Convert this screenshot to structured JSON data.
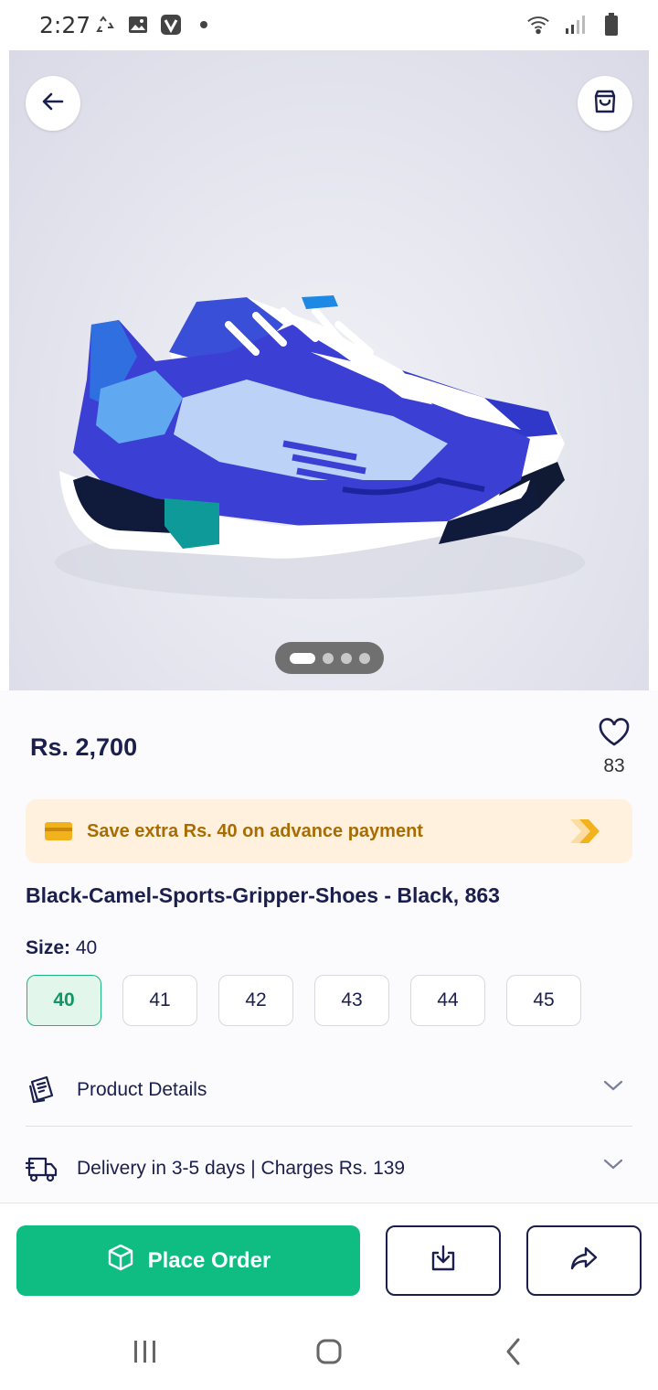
{
  "status_bar": {
    "time": "2:27",
    "left_icons": [
      "recycle-icon",
      "image-icon",
      "v-app-icon",
      "dot-icon"
    ],
    "right_icons": [
      "wifi-icon",
      "signal-icon",
      "battery-icon"
    ]
  },
  "hero": {
    "image": "blue-white-sports-shoe-photo",
    "pager": {
      "total": 4,
      "active_index": 0
    }
  },
  "product": {
    "price": "Rs. 2,700",
    "wishlist_count": "83",
    "promo_text": "Save extra Rs. 40 on advance payment",
    "title": "Black-Camel-Sports-Gripper-Shoes - Black, 863",
    "size_label": "Size:",
    "size_value": "40",
    "sizes": [
      "40",
      "41",
      "42",
      "43",
      "44",
      "45"
    ],
    "selected_size": "40"
  },
  "rows": {
    "details_label": "Product Details",
    "delivery_label": "Delivery in 3-5 days | Charges Rs. 139"
  },
  "actions": {
    "place_order_label": "Place Order"
  },
  "colors": {
    "primary": "#0fbd82",
    "text_dark": "#1a1f4d",
    "promo_bg": "#fff1de",
    "promo_text": "#a86c00"
  }
}
